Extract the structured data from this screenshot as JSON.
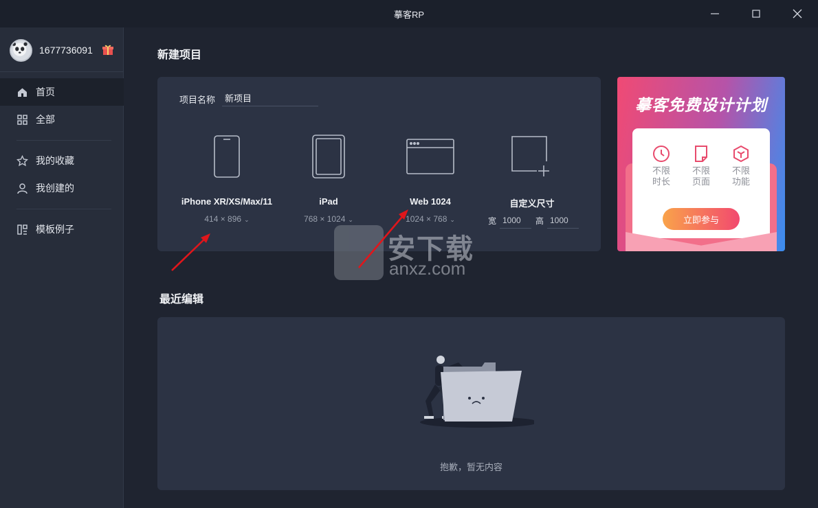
{
  "window": {
    "title": "摹客RP"
  },
  "sidebar": {
    "username": "1677736091",
    "items": [
      {
        "label": "首页",
        "icon": "home-icon"
      },
      {
        "label": "全部",
        "icon": "grid-icon"
      },
      {
        "label": "我的收藏",
        "icon": "star-icon"
      },
      {
        "label": "我创建的",
        "icon": "user-icon"
      },
      {
        "label": "模板例子",
        "icon": "template-icon"
      }
    ]
  },
  "new_project": {
    "section_title": "新建项目",
    "name_label": "项目名称",
    "name_value": "新项目",
    "devices": [
      {
        "name": "iPhone XR/XS/Max/11",
        "size": "414 × 896",
        "icon": "phone-icon"
      },
      {
        "name": "iPad",
        "size": "768 × 1024",
        "icon": "tablet-icon"
      },
      {
        "name": "Web 1024",
        "size": "1024 × 768",
        "icon": "browser-icon"
      },
      {
        "name": "自定义尺寸",
        "icon": "custom-size-icon"
      }
    ],
    "custom": {
      "width_label": "宽",
      "width_value": "1000",
      "height_label": "高",
      "height_value": "1000"
    }
  },
  "promo": {
    "title": "摹客免费设计计划",
    "features": [
      {
        "line1": "不限",
        "line2": "时长",
        "icon": "clock-icon"
      },
      {
        "line1": "不限",
        "line2": "页面",
        "icon": "page-icon"
      },
      {
        "line1": "不限",
        "line2": "功能",
        "icon": "cube-icon"
      }
    ],
    "button": "立即参与",
    "colors": {
      "start": "#f04a74",
      "end": "#3a8ef0",
      "accent": "#e84a6c"
    }
  },
  "recent": {
    "section_title": "最近编辑",
    "empty_text": "抱歉，暂无内容"
  },
  "watermark": {
    "text": "安下载",
    "sub": "anxz.com"
  },
  "colors": {
    "background": "#1f2430",
    "sidebar": "#272d3a",
    "card": "#2c3344",
    "annotation_arrow": "#e0161b"
  }
}
